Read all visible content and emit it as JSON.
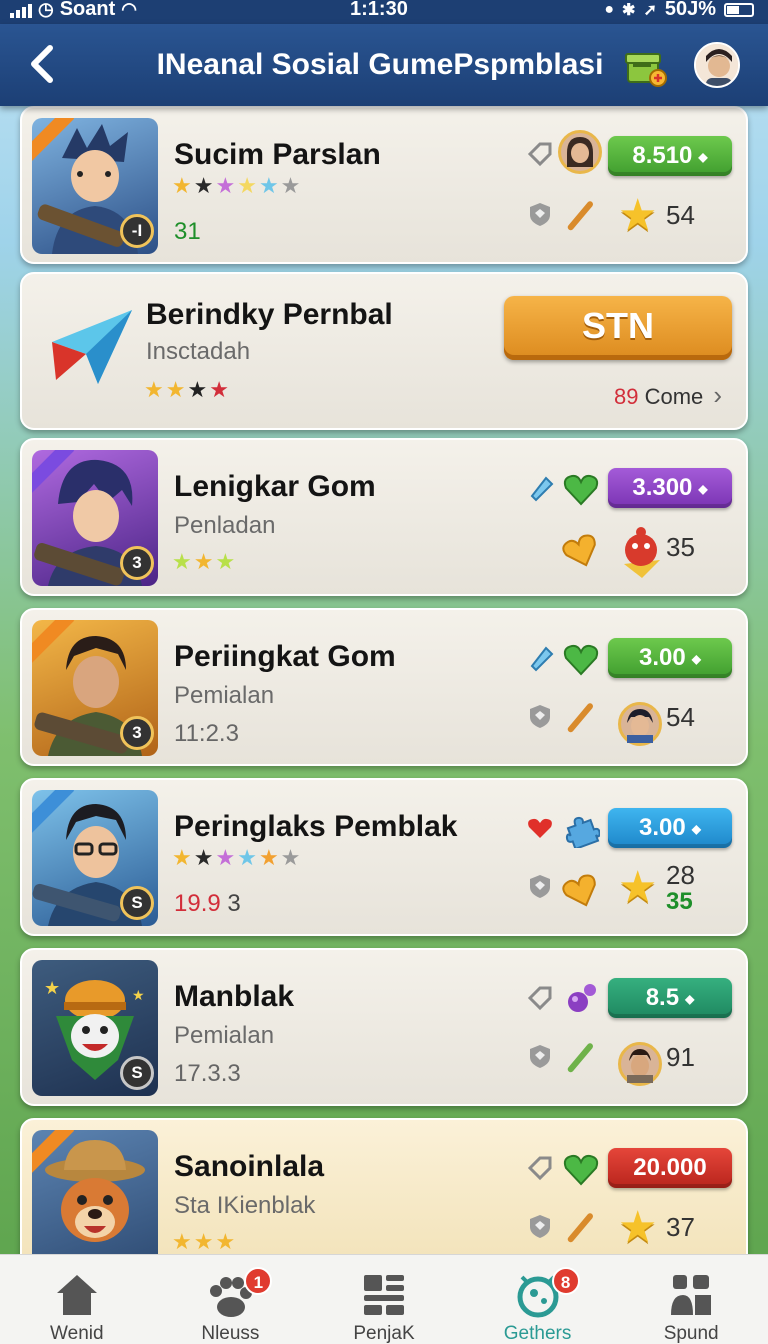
{
  "status_bar": {
    "carrier": "Soant",
    "time": "1:1:30",
    "battery": "50J%"
  },
  "header": {
    "title": "INeanal Sosial GumePspmblasi"
  },
  "colors": {
    "header": "#1d3f73",
    "accent_teal": "#2b9a94",
    "pill_green": "#4caf3c",
    "pill_purple": "#8e3fc4",
    "pill_blue": "#2a9fe0",
    "pill_teal": "#21966a",
    "pill_red": "#d63125",
    "cta_orange": "#e89c2c"
  },
  "cards": [
    {
      "title": "Sucim Parslan",
      "stars": [
        "★",
        "★",
        "★",
        "★",
        "★",
        "★"
      ],
      "meta": "31",
      "level": "-I",
      "pill": "8.510",
      "count": "54",
      "thumb": "hero-blue-hair"
    },
    {
      "title": "Berindky Pernbal",
      "subtitle": "Insctadah",
      "stars": [
        "★",
        "★",
        "★",
        "★"
      ],
      "cta": "STN",
      "more": "Come",
      "more_count": "89"
    },
    {
      "title": "Lenigkar Gom",
      "subtitle": "Penladan",
      "stars": [
        "★",
        "★",
        "★"
      ],
      "level": "3",
      "pill": "3.300",
      "count": "35",
      "thumb": "hero-purple"
    },
    {
      "title": "Periingkat Gom",
      "subtitle": "Pemialan",
      "meta": "11:2.3",
      "level": "3",
      "pill": "3.00",
      "count": "54",
      "thumb": "hero-gold"
    },
    {
      "title": "Peringlaks Pemblak",
      "stars": [
        "★",
        "★",
        "★",
        "★",
        "★",
        "★"
      ],
      "meta_red": "19.9",
      "meta": "3",
      "level": "S",
      "pill": "3.00",
      "count": "28",
      "count2": "35",
      "thumb": "hero-glasses"
    },
    {
      "title": "Manblak",
      "subtitle": "Pemialan",
      "meta": "17.3.3",
      "level": "S",
      "pill": "8.5",
      "count": "91",
      "thumb": "mascot-clown"
    },
    {
      "title": "Sanoinlala",
      "subtitle": "Sta IKienblak",
      "stars": [
        "★",
        "★",
        "★"
      ],
      "pill": "20.000",
      "count": "37",
      "thumb": "mascot-dog"
    }
  ],
  "nav": [
    {
      "label": "Wenid",
      "icon": "home-icon"
    },
    {
      "label": "Nleuss",
      "icon": "paw-icon",
      "badge": "1"
    },
    {
      "label": "PenjaK",
      "icon": "list-icon"
    },
    {
      "label": "Gethers",
      "icon": "target-icon",
      "badge": "8",
      "active": true
    },
    {
      "label": "Spund",
      "icon": "users-icon"
    }
  ]
}
